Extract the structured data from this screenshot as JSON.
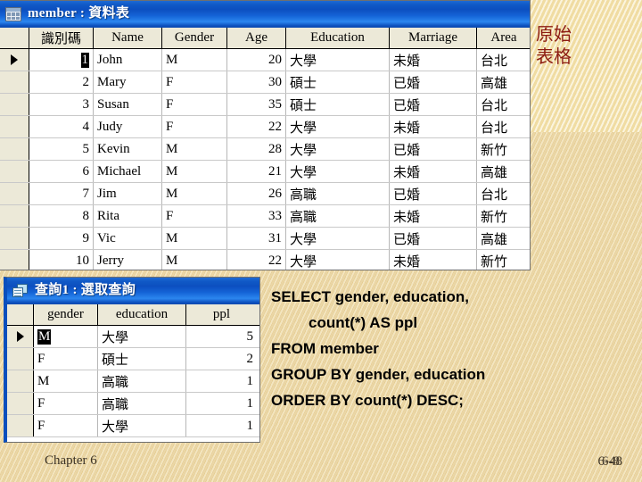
{
  "slide": {
    "background_color": "#f6e7b4",
    "footer_left": "Chapter 6",
    "page_number": "6-48",
    "page_number_overlap": "6-8"
  },
  "annotation": {
    "text": "原始\n表格",
    "color": "#8c1b12"
  },
  "table_window": {
    "title": "member : 資料表",
    "icon": "table-icon",
    "titlebar_color": "#0c4fc0",
    "columns": [
      "識別碼",
      "Name",
      "Gender",
      "Age",
      "Education",
      "Marriage",
      "Area"
    ],
    "selected_row_index": 0,
    "selected_cell_value": "1",
    "rows": [
      {
        "id": "1",
        "name": "John",
        "gender": "M",
        "age": "20",
        "education": "大學",
        "marriage": "未婚",
        "area": "台北"
      },
      {
        "id": "2",
        "name": "Mary",
        "gender": "F",
        "age": "30",
        "education": "碩士",
        "marriage": "已婚",
        "area": "高雄"
      },
      {
        "id": "3",
        "name": "Susan",
        "gender": "F",
        "age": "35",
        "education": "碩士",
        "marriage": "已婚",
        "area": "台北"
      },
      {
        "id": "4",
        "name": "Judy",
        "gender": "F",
        "age": "22",
        "education": "大學",
        "marriage": "未婚",
        "area": "台北"
      },
      {
        "id": "5",
        "name": "Kevin",
        "gender": "M",
        "age": "28",
        "education": "大學",
        "marriage": "已婚",
        "area": "新竹"
      },
      {
        "id": "6",
        "name": "Michael",
        "gender": "M",
        "age": "21",
        "education": "大學",
        "marriage": "未婚",
        "area": "高雄"
      },
      {
        "id": "7",
        "name": "Jim",
        "gender": "M",
        "age": "26",
        "education": "高職",
        "marriage": "已婚",
        "area": "台北"
      },
      {
        "id": "8",
        "name": "Rita",
        "gender": "F",
        "age": "33",
        "education": "高職",
        "marriage": "未婚",
        "area": "新竹"
      },
      {
        "id": "9",
        "name": "Vic",
        "gender": "M",
        "age": "31",
        "education": "大學",
        "marriage": "已婚",
        "area": "高雄"
      },
      {
        "id": "10",
        "name": "Jerry",
        "gender": "M",
        "age": "22",
        "education": "大學",
        "marriage": "未婚",
        "area": "新竹"
      }
    ]
  },
  "query_window": {
    "title": "查詢1 : 選取查詢",
    "icon": "query-icon",
    "titlebar_color": "#0c4fc0",
    "columns": [
      "gender",
      "education",
      "ppl"
    ],
    "selected_row_index": 0,
    "selected_cell_value": "M",
    "rows": [
      {
        "gender": "M",
        "education": "大學",
        "ppl": "5"
      },
      {
        "gender": "F",
        "education": "碩士",
        "ppl": "2"
      },
      {
        "gender": "M",
        "education": "高職",
        "ppl": "1"
      },
      {
        "gender": "F",
        "education": "高職",
        "ppl": "1"
      },
      {
        "gender": "F",
        "education": "大學",
        "ppl": "1"
      }
    ]
  },
  "sql": {
    "line1": "SELECT gender, education,",
    "line2": "count(*) AS ppl",
    "line3": "FROM member",
    "line4": "GROUP BY gender, education",
    "line5": "ORDER BY count(*) DESC;"
  }
}
